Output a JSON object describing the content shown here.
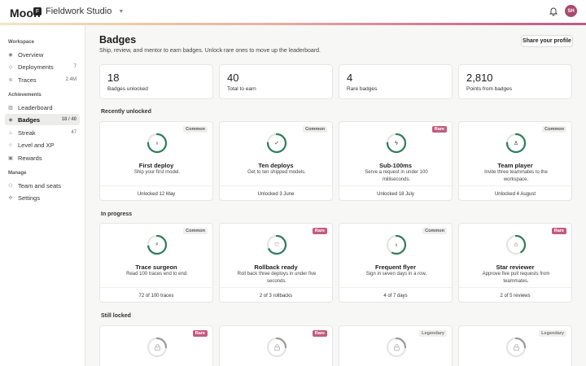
{
  "header": {
    "logo": "Moon",
    "workspace_initial": "F",
    "workspace_name": "Fieldwork Studio",
    "avatar_initials": "SH"
  },
  "sidebar": {
    "sections": [
      {
        "title": "Workspace",
        "items": [
          {
            "label": "Overview",
            "icon": "eye-icon",
            "count": ""
          },
          {
            "label": "Deployments",
            "icon": "rocket-icon",
            "count": "7"
          },
          {
            "label": "Traces",
            "icon": "trace-icon",
            "count": "2.4M"
          }
        ]
      },
      {
        "title": "Achievements",
        "items": [
          {
            "label": "Leaderboard",
            "icon": "bar-chart-icon",
            "count": ""
          },
          {
            "label": "Badges",
            "icon": "badge-icon",
            "count": "18 / 40",
            "active": true
          },
          {
            "label": "Streak",
            "icon": "flame-icon",
            "count": "47"
          },
          {
            "label": "Level and XP",
            "icon": "star-icon",
            "count": ""
          },
          {
            "label": "Rewards",
            "icon": "gift-icon",
            "count": ""
          }
        ]
      },
      {
        "title": "Manage",
        "items": [
          {
            "label": "Team and seats",
            "icon": "users-icon",
            "count": ""
          },
          {
            "label": "Settings",
            "icon": "gear-icon",
            "count": ""
          }
        ]
      }
    ]
  },
  "main": {
    "title": "Badges",
    "subtitle": "Ship, review, and mentor to earn badges. Unlock rare ones to move up the leaderboard.",
    "share_label": "Share your profile",
    "stats": [
      {
        "value": "18",
        "label": "Badges unlocked"
      },
      {
        "value": "40",
        "label": "Total to earn"
      },
      {
        "value": "4",
        "label": "Rare badges"
      },
      {
        "value": "2,810",
        "label": "Points from badges"
      }
    ],
    "recent_heading": "Recently unlocked",
    "recent": [
      {
        "tag": "Common",
        "tag_kind": "common",
        "icon": "flame-icon",
        "glyph": "♁",
        "name": "First deploy",
        "desc": "Ship your first model.",
        "foot": "Unlocked 12 May",
        "progress": 0.75
      },
      {
        "tag": "Common",
        "tag_kind": "common",
        "icon": "check-icon",
        "glyph": "✓",
        "name": "Ten deploys",
        "desc": "Get to ten shipped models.",
        "foot": "Unlocked 3 June",
        "progress": 0.75
      },
      {
        "tag": "Rare",
        "tag_kind": "rare",
        "icon": "bolt-icon",
        "glyph": "ϟ",
        "name": "Sub-100ms",
        "desc": "Serve a request in under 100 milliseconds.",
        "foot": "Unlocked 18 July",
        "progress": 0.75
      },
      {
        "tag": "Common",
        "tag_kind": "common",
        "icon": "person-icon",
        "glyph": "♙",
        "name": "Team player",
        "desc": "Invite three teammates to the workspace.",
        "foot": "Unlocked 4 August",
        "progress": 0.75
      }
    ],
    "progress_heading": "In progress",
    "in_progress": [
      {
        "tag": "Common",
        "tag_kind": "common",
        "icon": "search-icon",
        "glyph": "⌕",
        "name": "Trace surgeon",
        "desc": "Read 100 traces end to end.",
        "foot": "72 of 100 traces",
        "progress": 0.72
      },
      {
        "tag": "Rare",
        "tag_kind": "rare",
        "icon": "shield-icon",
        "glyph": "♡",
        "name": "Rollback ready",
        "desc": "Roll back three deploys in under five seconds.",
        "foot": "2 of 3 rollbacks",
        "progress": 0.667
      },
      {
        "tag": "Common",
        "tag_kind": "common",
        "icon": "flame-icon",
        "glyph": "♁",
        "name": "Frequent flyer",
        "desc": "Sign in seven days in a row.",
        "foot": "4 of 7 days",
        "progress": 0.571
      },
      {
        "tag": "Rare",
        "tag_kind": "rare",
        "icon": "star-icon",
        "glyph": "☆",
        "name": "Star reviewer",
        "desc": "Approve five pull requests from teammates.",
        "foot": "2 of 5 reviews",
        "progress": 0.4
      }
    ],
    "locked_heading": "Still locked",
    "locked": [
      {
        "tag": "Rare",
        "tag_kind": "rare",
        "icon": "lock-icon",
        "progress": 0.25
      },
      {
        "tag": "Rare",
        "tag_kind": "rare",
        "icon": "lock-icon",
        "progress": 0.25
      },
      {
        "tag": "Legendary",
        "tag_kind": "legendary",
        "icon": "lock-icon",
        "progress": 0.25
      },
      {
        "tag": "Legendary",
        "tag_kind": "legendary",
        "icon": "lock-icon",
        "progress": 0.25
      }
    ]
  },
  "colors": {
    "accent": "#2e7d5b",
    "rare": "#c45a7d",
    "ring_track": "#e4e4e2",
    "locked_ring": "#9a9a98"
  }
}
